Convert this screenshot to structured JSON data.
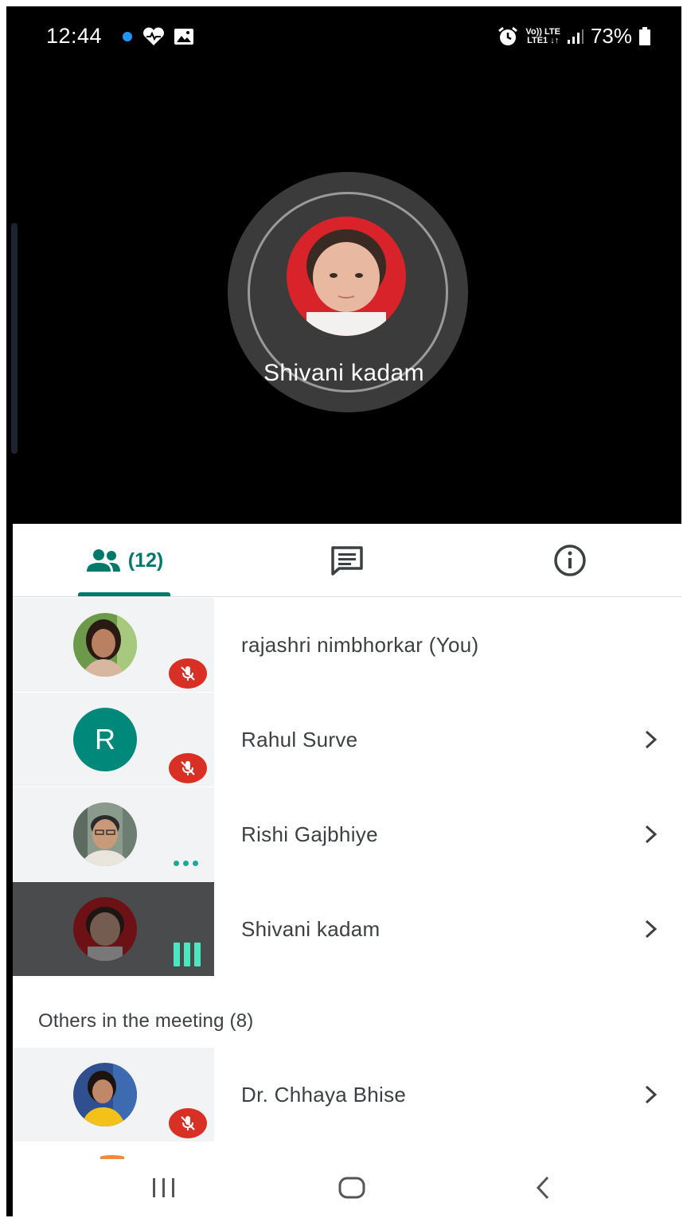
{
  "status_bar": {
    "time": "12:44",
    "network_top": "Vo)) LTE",
    "network_bottom": "LTE1 ↓↑",
    "battery": "73%",
    "icons": [
      "dot-icon",
      "heart-icon",
      "image-icon",
      "alarm-icon",
      "signal-icon",
      "battery-icon"
    ]
  },
  "stage": {
    "active_speaker": "Shivani kadam"
  },
  "tabs": {
    "people_count": "(12)",
    "icons": [
      "people-icon",
      "chat-icon",
      "info-icon"
    ],
    "accent_color": "#00796b"
  },
  "participants": [
    {
      "name": "rajashri nimbhorkar (You)",
      "status": "muted",
      "avatar": "photo"
    },
    {
      "name": "Rahul Surve",
      "status": "muted",
      "avatar": "letter",
      "initial": "R"
    },
    {
      "name": "Rishi Gajbhiye",
      "status": "connecting",
      "avatar": "photo"
    },
    {
      "name": "Shivani kadam",
      "status": "speaking",
      "avatar": "photo"
    }
  ],
  "others": {
    "label": "Others in the meeting (8)",
    "items": [
      {
        "name": "Dr. Chhaya Bhise",
        "status": "muted",
        "avatar": "photo"
      }
    ]
  },
  "colors": {
    "muted_badge": "#d93025",
    "speaking_bars": "#4de6c0",
    "avatar_letter_bg": "#00897b"
  },
  "navbar": {
    "icons": [
      "recent-apps-icon",
      "home-icon",
      "back-icon"
    ]
  }
}
